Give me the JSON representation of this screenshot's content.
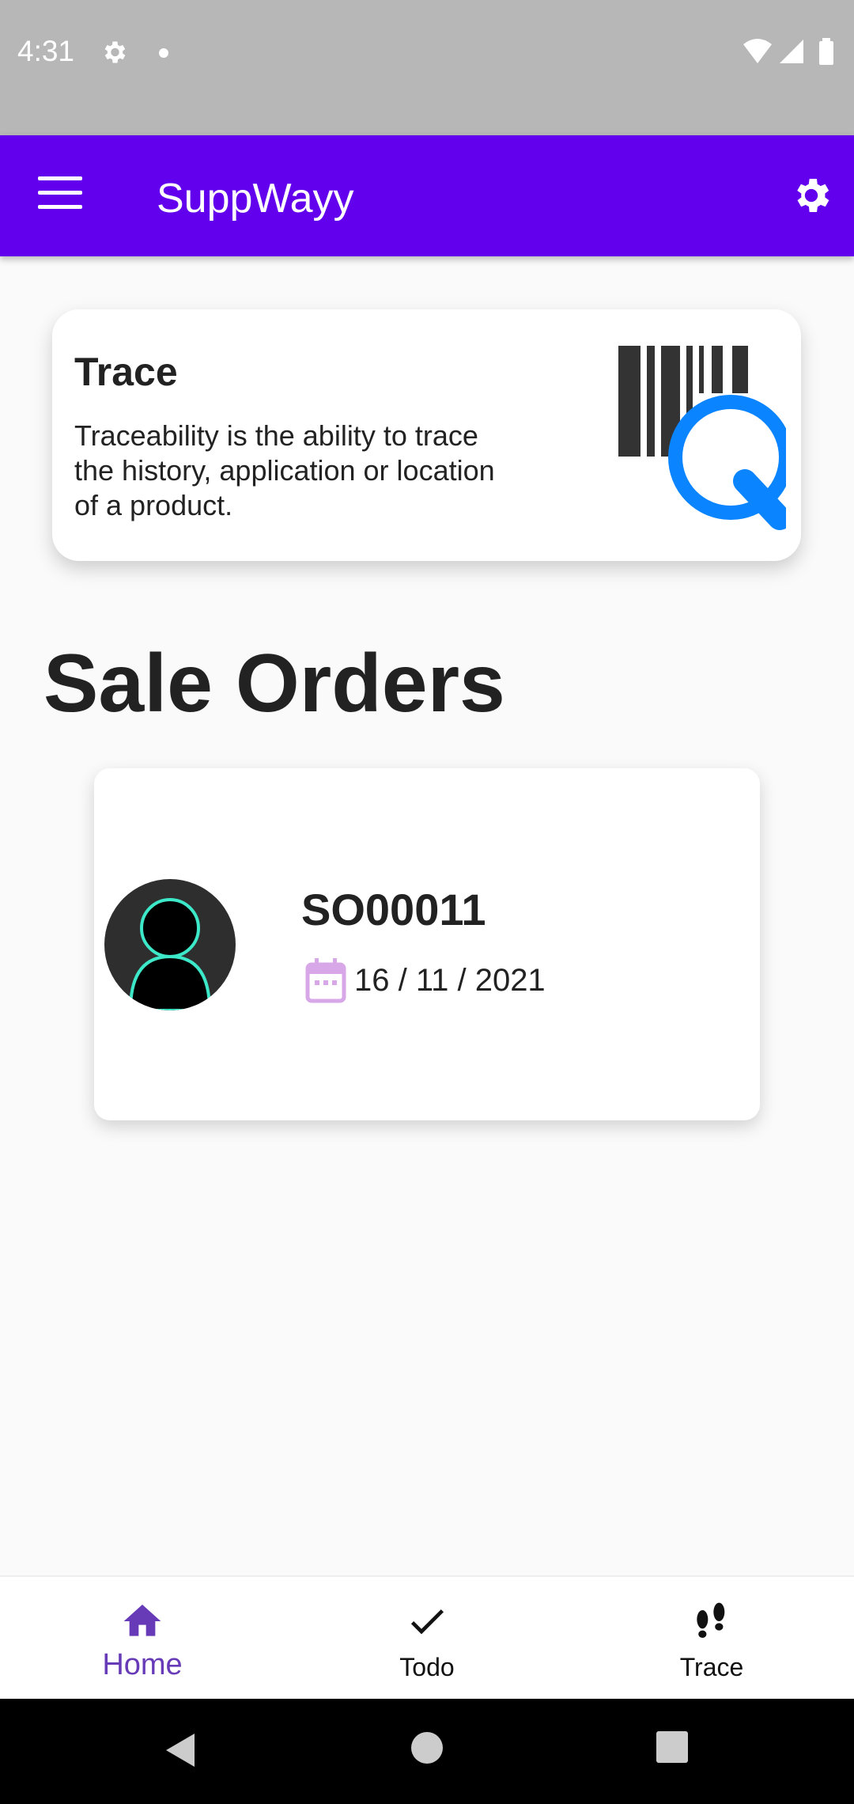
{
  "status_bar": {
    "time": "4:31",
    "icons": [
      "gear-icon",
      "notification-dot-icon",
      "wifi-icon",
      "signal-icon",
      "battery-icon"
    ]
  },
  "app_bar": {
    "title": "SuppWayy",
    "menu_icon": "menu-icon",
    "settings_icon": "settings-icon",
    "background": "#6200ee"
  },
  "trace_card": {
    "title": "Trace",
    "description": "Traceability is the ability to trace the history, application or location of a product.",
    "illustration": "barcode-search-icon",
    "accent": "#0a84ff"
  },
  "sale_orders": {
    "heading": "Sale Orders",
    "orders": [
      {
        "id": "SO00011",
        "date": "16 / 11 / 2021",
        "avatar": "user-avatar-icon",
        "date_icon": "calendar-icon"
      }
    ]
  },
  "bottom_nav": {
    "active_color": "#673ab7",
    "items": [
      {
        "label": "Home",
        "icon": "home-icon",
        "active": true
      },
      {
        "label": "Todo",
        "icon": "check-icon",
        "active": false
      },
      {
        "label": "Trace",
        "icon": "footprints-icon",
        "active": false
      }
    ]
  },
  "system_nav": {
    "buttons": [
      "back-icon",
      "home-circle-icon",
      "recents-icon"
    ]
  }
}
